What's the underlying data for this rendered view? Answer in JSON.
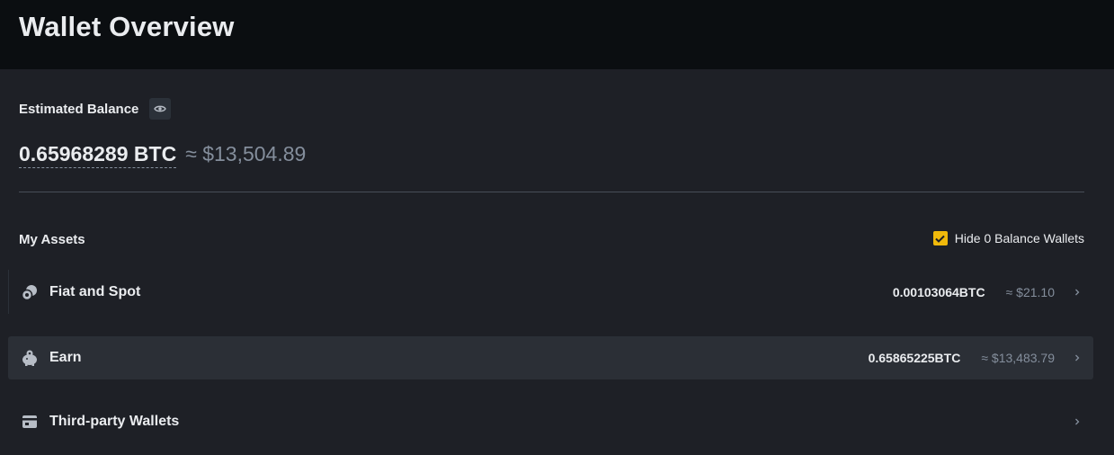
{
  "header": {
    "title": "Wallet Overview"
  },
  "balance": {
    "label": "Estimated Balance",
    "btc": "0.65968289 BTC",
    "usd": "≈ $13,504.89"
  },
  "assets": {
    "title": "My Assets",
    "hide_zero_label": "Hide 0 Balance Wallets",
    "hide_zero_checked": true,
    "rows": [
      {
        "label": "Fiat and Spot",
        "btc": "0.00103064BTC",
        "usd": "≈ $21.10",
        "icon": "wallet-spot-icon"
      },
      {
        "label": "Earn",
        "btc": "0.65865225BTC",
        "usd": "≈ $13,483.79",
        "icon": "piggy-bank-icon"
      },
      {
        "label": "Third-party Wallets",
        "btc": "",
        "usd": "",
        "icon": "third-party-wallet-icon"
      }
    ]
  },
  "colors": {
    "header_bg": "#0b0e11",
    "page_bg": "#1e2026",
    "accent": "#f0b90b",
    "muted_text": "#848e9c",
    "row_hover_bg": "#2b2f36"
  }
}
